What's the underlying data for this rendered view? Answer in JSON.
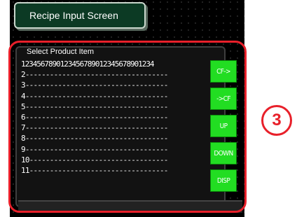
{
  "title": "Recipe Input Screen",
  "panel": {
    "header": "Select Product Item",
    "rows": [
      "1234567890123456789012345678901234",
      "2-----------------------------------",
      "3-----------------------------------",
      "4-----------------------------------",
      "5-----------------------------------",
      "6-----------------------------------",
      "7-----------------------------------",
      "8-----------------------------------",
      "9-----------------------------------",
      "10----------------------------------",
      "11----------------------------------"
    ]
  },
  "buttons": {
    "cf_right": "CF->",
    "cf_left": "->CF",
    "up": "UP",
    "down": "DOWN",
    "disp": "DISP"
  },
  "callout": {
    "label": "3"
  },
  "colors": {
    "highlight": "#e8202a",
    "button": "#22dd22",
    "title_bg": "#0c3a24"
  }
}
